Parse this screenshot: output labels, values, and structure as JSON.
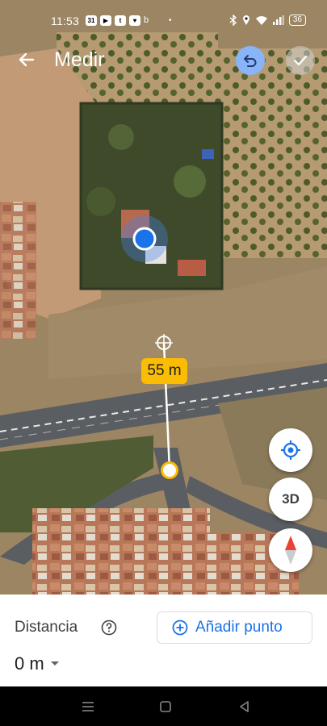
{
  "status_bar": {
    "time": "11:53",
    "notifications": [
      "31",
      "▶",
      "t",
      "♥"
    ],
    "extra_icon": "b",
    "dot": "•",
    "battery": "36",
    "icons": [
      "bluetooth-icon",
      "location-icon",
      "wifi-icon",
      "signal-icon",
      "battery-icon"
    ]
  },
  "app_bar": {
    "title": "Medir",
    "back_icon": "arrow-back-icon",
    "undo_icon": "undo-icon",
    "confirm_icon": "check-icon"
  },
  "map": {
    "measure_label": "55 m",
    "map_type": "satellite"
  },
  "fabs": {
    "location_icon": "my-location-icon",
    "view_3d_label": "3D",
    "compass_icon": "compass-icon"
  },
  "bottom_sheet": {
    "distance_label": "Distancia",
    "add_point_label": "Añadir punto",
    "distance_value": "0 m"
  },
  "colors": {
    "accent": "#1a73e8",
    "measure_label_bg": "#fbbc04",
    "undo_bg": "#8ab4f8"
  },
  "nav_bar": {
    "icons": [
      "recents-icon",
      "home-icon",
      "back-nav-icon"
    ]
  }
}
